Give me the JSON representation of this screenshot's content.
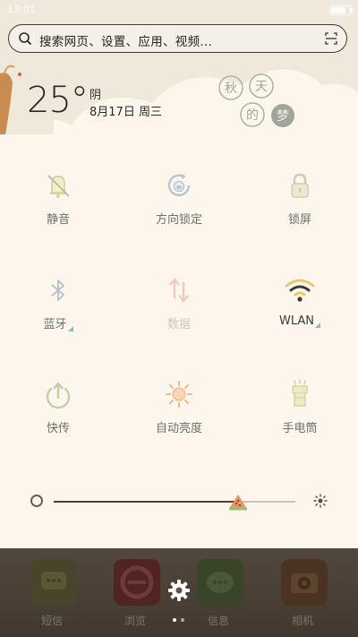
{
  "status_bar": {
    "time": "13:01"
  },
  "search": {
    "placeholder": "搜索网页、设置、应用、视频..."
  },
  "weather": {
    "temperature": "25°",
    "condition": "阴",
    "date": "8月17日 周三"
  },
  "logo_text": "秋天的梦",
  "toggles": [
    {
      "label": "静音",
      "icon": "mute-bell-icon",
      "state": "off"
    },
    {
      "label": "方向锁定",
      "icon": "rotation-lock-icon",
      "state": "off"
    },
    {
      "label": "锁屏",
      "icon": "lock-screen-icon",
      "state": "off"
    },
    {
      "label": "蓝牙",
      "icon": "bluetooth-icon",
      "state": "off",
      "has_more": true
    },
    {
      "label": "数据",
      "icon": "mobile-data-icon",
      "state": "disabled"
    },
    {
      "label": "WLAN",
      "icon": "wifi-icon",
      "state": "on",
      "has_more": true
    },
    {
      "label": "快传",
      "icon": "quick-share-icon",
      "state": "off"
    },
    {
      "label": "自动亮度",
      "icon": "auto-brightness-icon",
      "state": "off"
    },
    {
      "label": "手电筒",
      "icon": "flashlight-icon",
      "state": "off"
    }
  ],
  "brightness": {
    "level": 0.77
  },
  "dock": {
    "apps": [
      {
        "label": "短信",
        "icon": "messages-icon"
      },
      {
        "label": "浏览",
        "icon": "browser-icon"
      },
      {
        "label": "信息",
        "icon": "chat-icon"
      },
      {
        "label": "相机",
        "icon": "camera-icon"
      }
    ],
    "pages": 2,
    "current_page": 0
  },
  "colors": {
    "panel_bg": "#fdf6ec",
    "icon_gray": "#b9b5a8",
    "active_icon": "#e7c86c",
    "brightness_thumb": "#e98b5f"
  }
}
